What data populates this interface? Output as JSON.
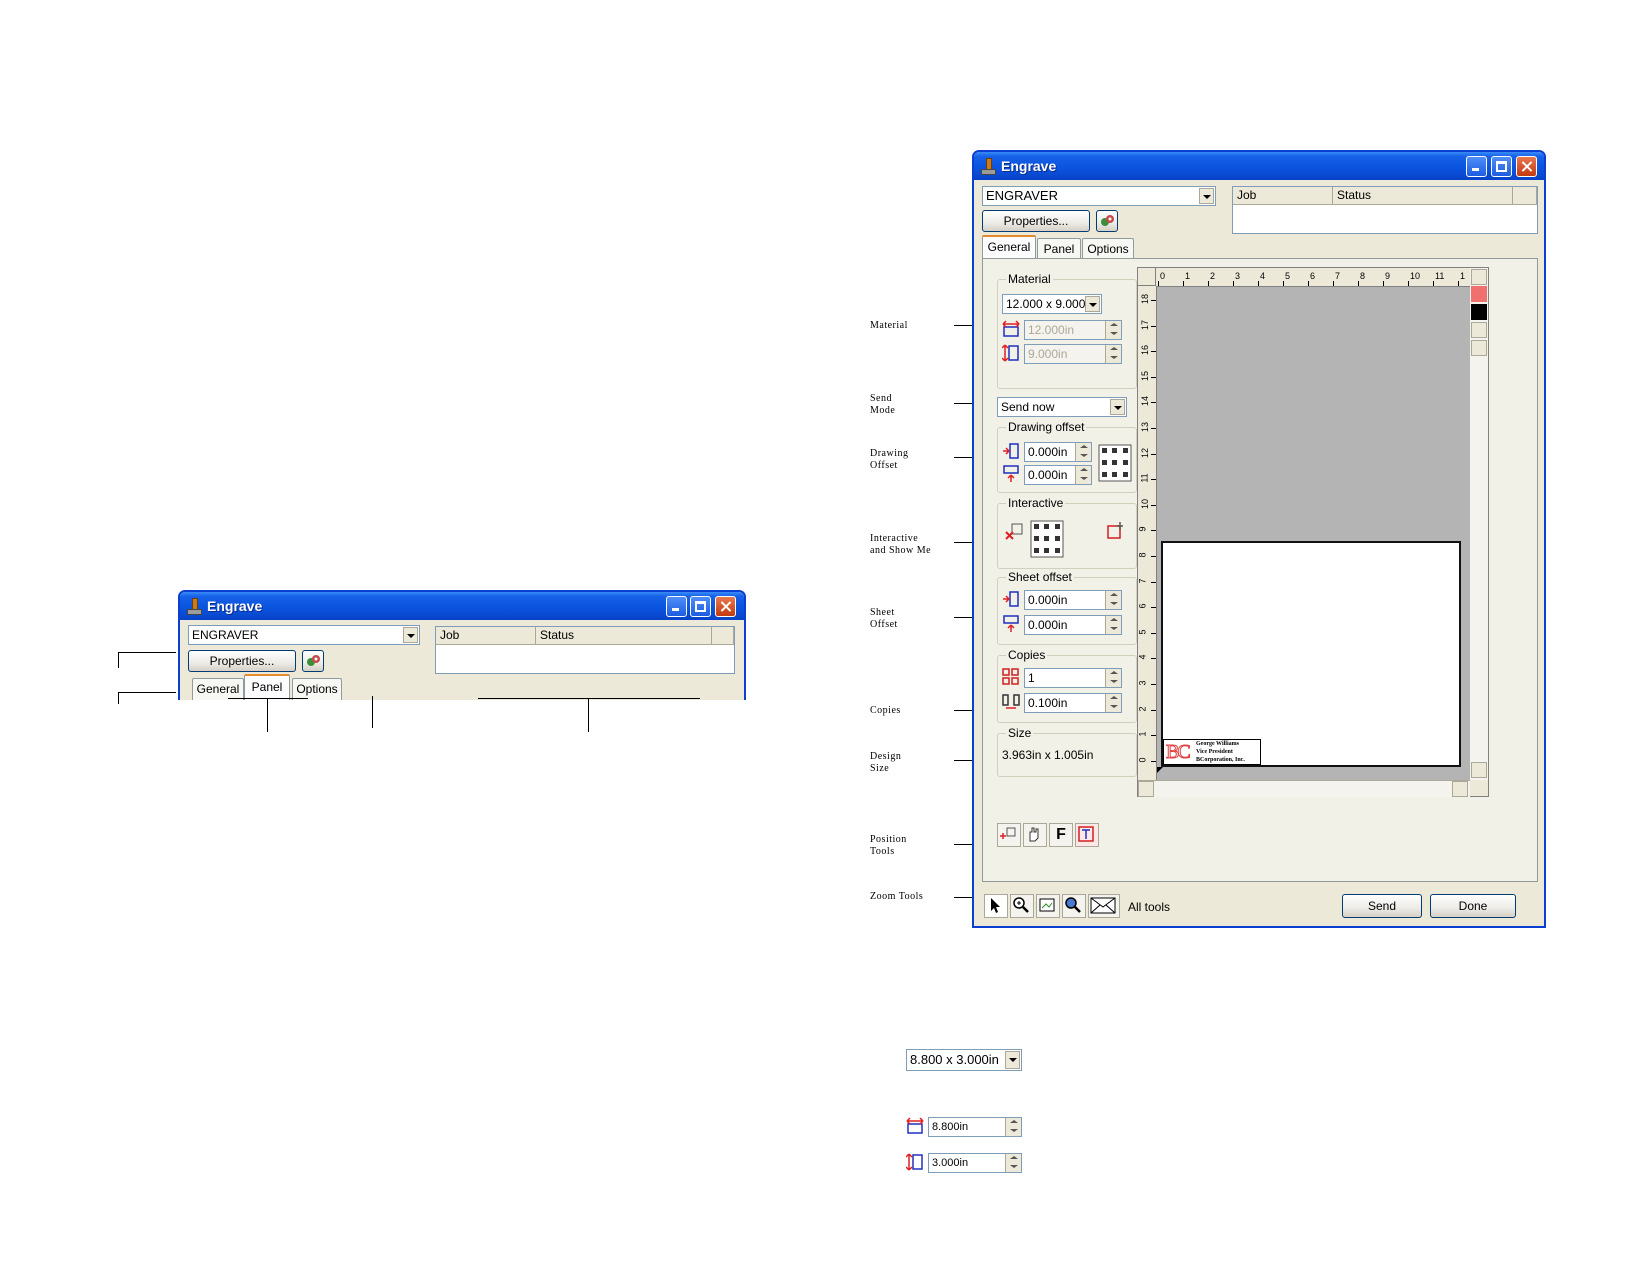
{
  "app": {
    "title": "Engrave"
  },
  "device": {
    "selected": "ENGRAVER"
  },
  "toolbar": {
    "properties_label": "Properties..."
  },
  "queue": {
    "col_job": "Job",
    "col_status": "Status"
  },
  "tabs": [
    "General",
    "Panel",
    "Options"
  ],
  "material": {
    "group_label": "Material",
    "preset": "12.000 x 9.000",
    "width": "12.000in",
    "height": "9.000in"
  },
  "send_mode": {
    "selected": "Send now"
  },
  "drawing_offset": {
    "group_label": "Drawing offset",
    "x": "0.000in",
    "y": "0.000in"
  },
  "interactive": {
    "group_label": "Interactive"
  },
  "sheet_offset": {
    "group_label": "Sheet offset",
    "x": "0.000in",
    "y": "0.000in"
  },
  "copies": {
    "group_label": "Copies",
    "count": "1",
    "spacing": "0.100in"
  },
  "size": {
    "group_label": "Size",
    "value": "3.963in x 1.005in"
  },
  "bottom": {
    "all_tools_label": "All tools",
    "send_label": "Send",
    "done_label": "Done"
  },
  "ruler": {
    "horizontal": [
      "0",
      "1",
      "2",
      "3",
      "4",
      "5",
      "6",
      "7",
      "8",
      "9",
      "10",
      "11",
      "1"
    ],
    "vertical": [
      "18",
      "17",
      "16",
      "15",
      "14",
      "13",
      "12",
      "11",
      "10",
      "9",
      "8",
      "7",
      "6",
      "5",
      "4",
      "3",
      "2",
      "1",
      "0"
    ]
  },
  "preview": {
    "logo": "BC",
    "card_lines": [
      "George Williams",
      "Vice President",
      "BCorporation, Inc."
    ]
  },
  "annotations": {
    "material": "Material",
    "send_mode": "Send\nMode",
    "drawing_offset": "Drawing\nOffset",
    "interactive": "Interactive\nand Show Me",
    "sheet_offset": "Sheet\nOffset",
    "copies": "Copies",
    "design_size": "Design\nSize",
    "position_tools": "Position\nTools",
    "zoom_tools": "Zoom Tools"
  },
  "example": {
    "preset": "8.800 x 3.000in",
    "width": "8.800in",
    "height": "3.000in"
  },
  "colors": {
    "title_bar": "#0b54df",
    "window_bg": "#ece9d8",
    "canvas_bg": "#b4b4b4",
    "swatch_red": "#f07070",
    "swatch_black": "#000000"
  }
}
